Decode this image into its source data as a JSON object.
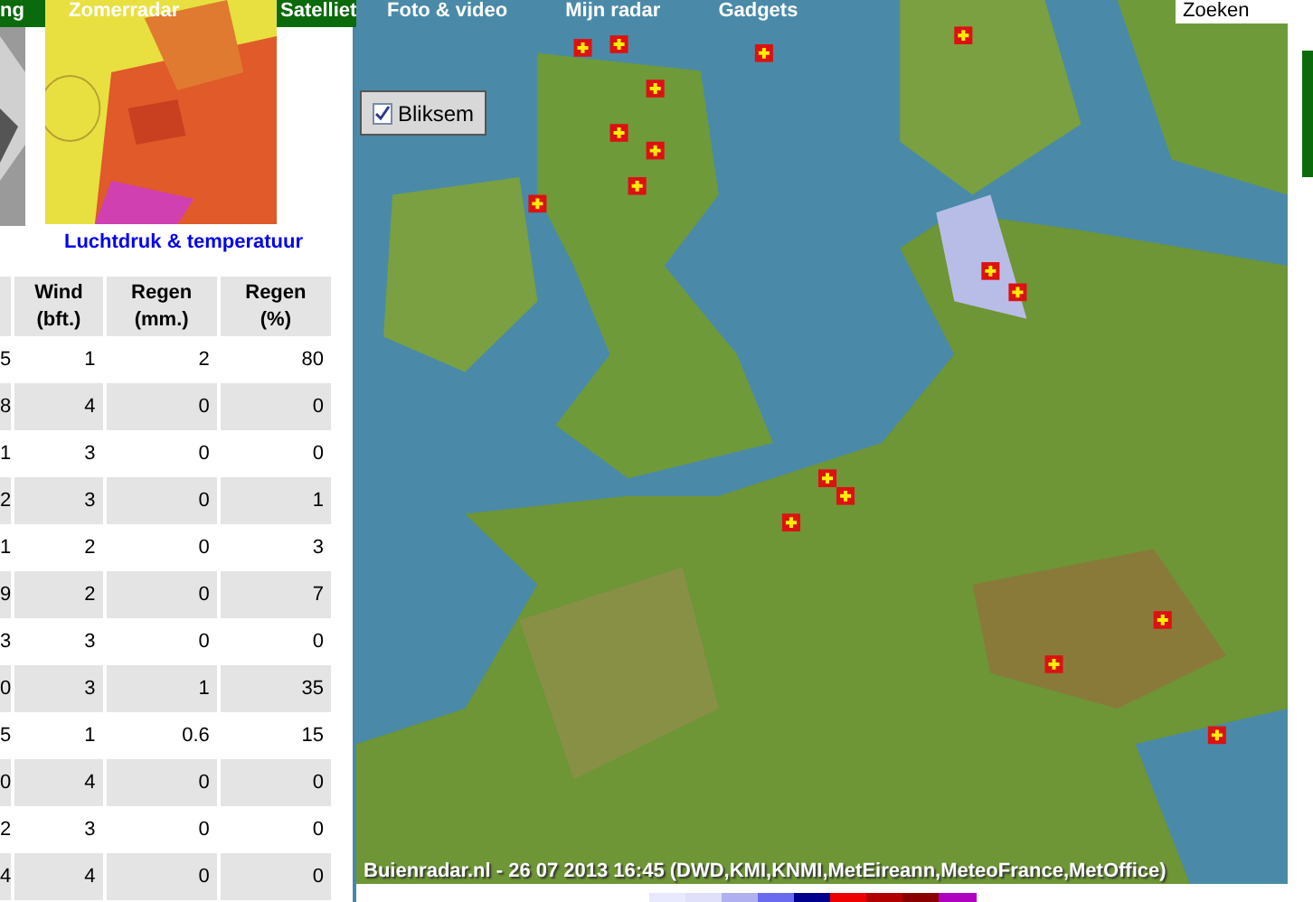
{
  "nav": [
    {
      "label": "ng"
    },
    {
      "label": "Zomerradar"
    },
    {
      "label": "Satelliet"
    },
    {
      "label": "Foto & video"
    },
    {
      "label": "Mijn radar"
    },
    {
      "label": "Gadgets"
    }
  ],
  "search": {
    "placeholder": "Zoeken"
  },
  "thumbnail": {
    "caption": "Luchtdruk & temperatuur"
  },
  "table": {
    "columns": [
      "",
      "Wind\n(bft.)",
      "Regen\n(mm.)",
      "Regen\n(%)"
    ],
    "rows": [
      {
        "cells": [
          "5",
          "1",
          "2",
          "80"
        ]
      },
      {
        "cells": [
          "8",
          "4",
          "0",
          "0"
        ]
      },
      {
        "cells": [
          "1",
          "3",
          "0",
          "0"
        ]
      },
      {
        "cells": [
          "2",
          "3",
          "0",
          "1"
        ]
      },
      {
        "cells": [
          "1",
          "2",
          "0",
          "3"
        ]
      },
      {
        "cells": [
          "9",
          "2",
          "0",
          "7"
        ]
      },
      {
        "cells": [
          "3",
          "3",
          "0",
          "0"
        ]
      },
      {
        "cells": [
          "0",
          "3",
          "1",
          "35"
        ]
      },
      {
        "cells": [
          "5",
          "1",
          "0.6",
          "15"
        ]
      },
      {
        "cells": [
          "0",
          "4",
          "0",
          "0"
        ]
      },
      {
        "cells": [
          "2",
          "3",
          "0",
          "0"
        ]
      },
      {
        "cells": [
          "4",
          "4",
          "0",
          "0"
        ]
      }
    ]
  },
  "map": {
    "layer": {
      "label": "Bliksem",
      "checked": true
    },
    "caption": "Buienradar.nl - 26 07 2013 16:45 (DWD,KMI,KNMI,MetEireann,MeteoFrance,MetOffice)"
  }
}
